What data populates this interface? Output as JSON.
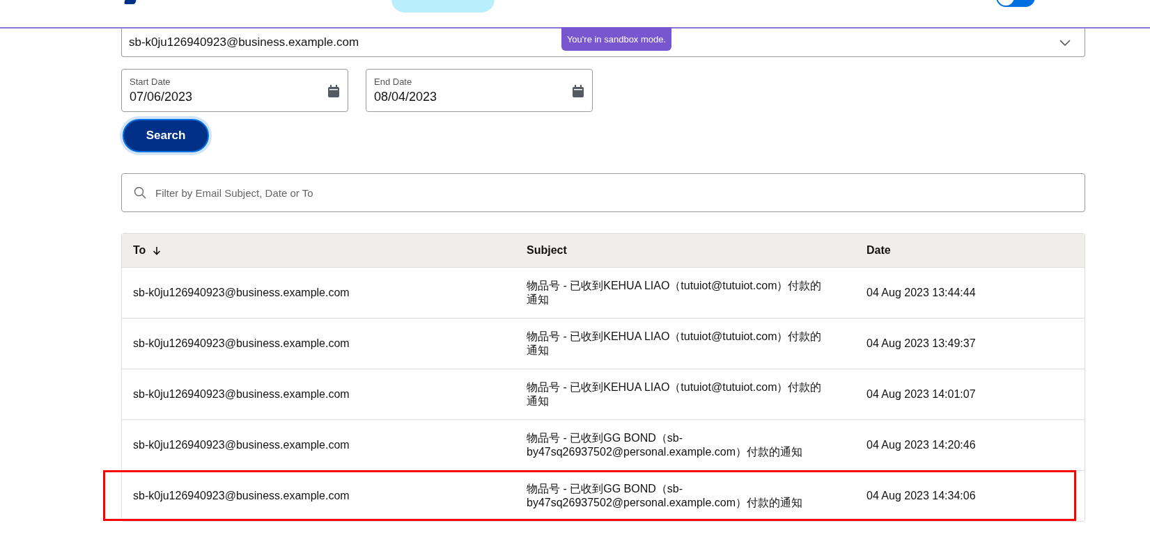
{
  "environment_toggle": {
    "on": false
  },
  "sandbox_banner": "You're in sandbox mode.",
  "account_select": {
    "value": "sb-k0ju126940923@business.example.com"
  },
  "start_date": {
    "label": "Start Date",
    "value": "07/06/2023"
  },
  "end_date": {
    "label": "End Date",
    "value": "08/04/2023"
  },
  "search_button": "Search",
  "filter": {
    "placeholder": "Filter by Email Subject, Date or To"
  },
  "table": {
    "columns": [
      {
        "label": "To",
        "sorted": true
      },
      {
        "label": "Subject",
        "sorted": false
      },
      {
        "label": "Date",
        "sorted": false
      }
    ],
    "rows": [
      {
        "to": "sb-k0ju126940923@business.example.com",
        "subject": "物品号 - 已收到KEHUA LIAO（tutuiot@tutuiot.com）付款的通知",
        "date": "04 Aug 2023 13:44:44",
        "highlighted": false
      },
      {
        "to": "sb-k0ju126940923@business.example.com",
        "subject": "物品号 - 已收到KEHUA LIAO（tutuiot@tutuiot.com）付款的通知",
        "date": "04 Aug 2023 13:49:37",
        "highlighted": false
      },
      {
        "to": "sb-k0ju126940923@business.example.com",
        "subject": "物品号 - 已收到KEHUA LIAO（tutuiot@tutuiot.com）付款的通知",
        "date": "04 Aug 2023 14:01:07",
        "highlighted": false
      },
      {
        "to": "sb-k0ju126940923@business.example.com",
        "subject": "物品号 - 已收到GG BOND（sb-by47sq26937502@personal.example.com）付款的通知",
        "date": "04 Aug 2023 14:20:46",
        "highlighted": false
      },
      {
        "to": "sb-k0ju126940923@business.example.com",
        "subject": "物品号 - 已收到GG BOND（sb-by47sq26937502@personal.example.com）付款的通知",
        "date": "04 Aug 2023 14:34:06",
        "highlighted": true
      }
    ]
  }
}
